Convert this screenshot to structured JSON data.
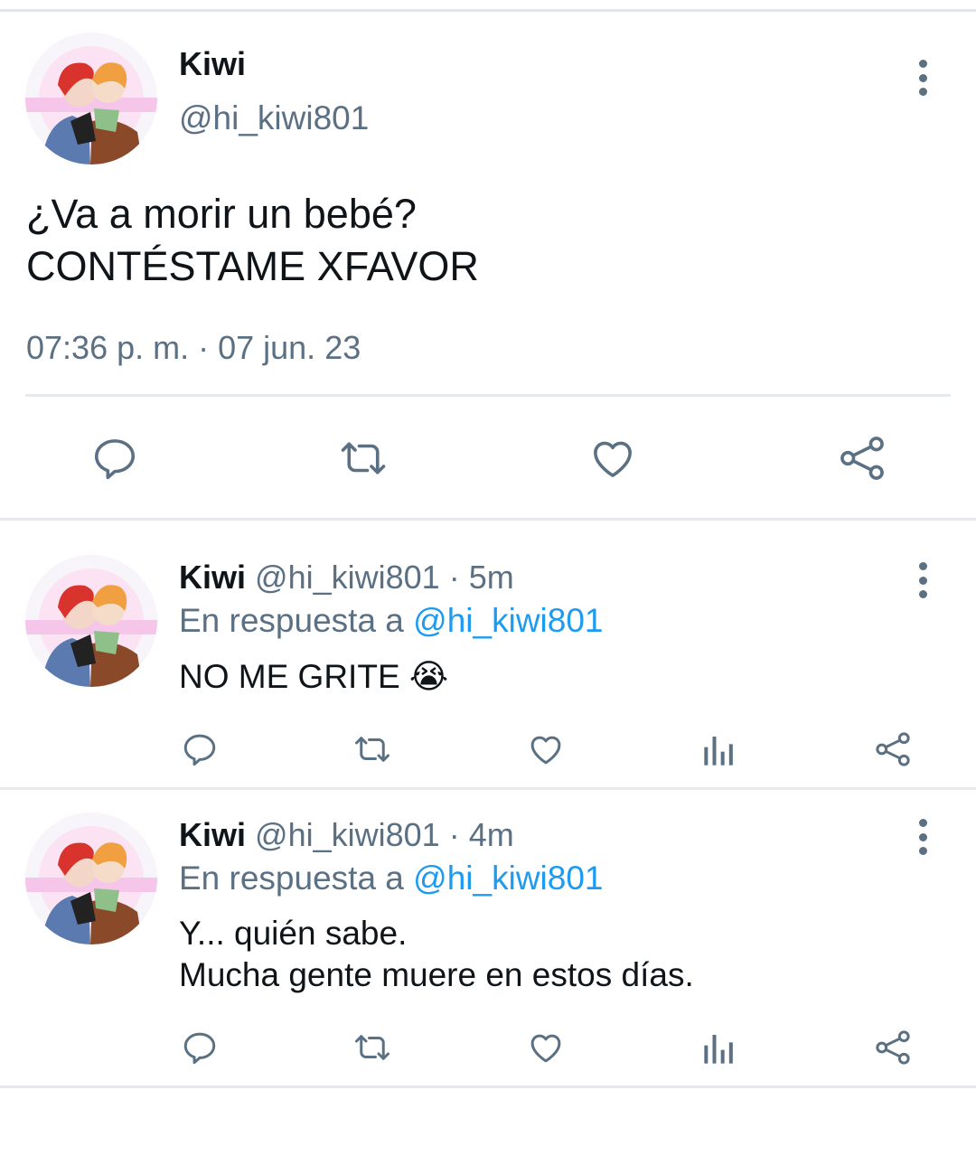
{
  "main_tweet": {
    "author_name": "Kiwi",
    "author_handle": "@hi_kiwi801",
    "text_line1": "¿Va a morir un bebé?",
    "text_line2": "CONTÉSTAME XFAVOR",
    "timestamp": "07:36 p. m. · 07 jun. 23",
    "actions": [
      "reply-icon",
      "retweet-icon",
      "like-icon",
      "share-icon"
    ]
  },
  "replies": [
    {
      "author_name": "Kiwi",
      "author_handle": "@hi_kiwi801",
      "time": "· 5m",
      "reply_prefix": "En respuesta a",
      "reply_to": "@hi_kiwi801",
      "text_line1": "NO ME GRITE 😭",
      "text_line2": ""
    },
    {
      "author_name": "Kiwi",
      "author_handle": "@hi_kiwi801",
      "time": "· 4m",
      "reply_prefix": "En respuesta a",
      "reply_to": "@hi_kiwi801",
      "text_line1": "Y... quién sabe.",
      "text_line2": "Mucha gente muere en estos días."
    }
  ],
  "colors": {
    "text": "#0f1419",
    "secondary": "#5b7083",
    "link": "#1d9bf0",
    "divider": "#e6eaee"
  }
}
